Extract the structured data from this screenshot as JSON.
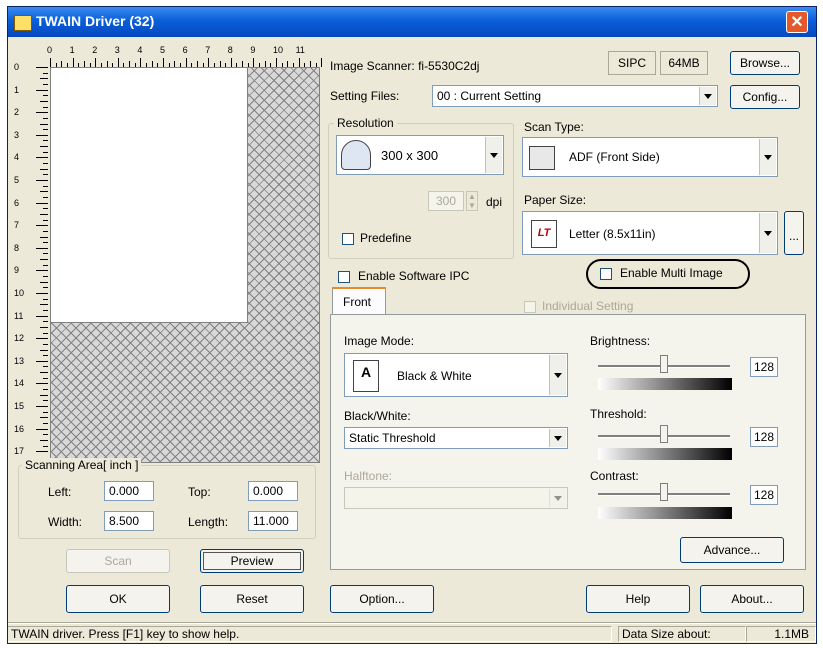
{
  "window": {
    "title": "TWAIN Driver (32)"
  },
  "preview": {
    "ruler_top": [
      "0",
      "1",
      "2",
      "3",
      "4",
      "5",
      "6",
      "7",
      "8",
      "9",
      "10",
      "11"
    ],
    "ruler_left": [
      "0",
      "1",
      "2",
      "3",
      "4",
      "5",
      "6",
      "7",
      "8",
      "9",
      "10",
      "11",
      "12",
      "13",
      "14",
      "15",
      "16",
      "17"
    ]
  },
  "scanning_area": {
    "title": "Scanning Area[ inch ]",
    "left_label": "Left:",
    "left_value": "0.000",
    "top_label": "Top:",
    "top_value": "0.000",
    "width_label": "Width:",
    "width_value": "8.500",
    "length_label": "Length:",
    "length_value": "11.000"
  },
  "buttons": {
    "scan": "Scan",
    "preview": "Preview",
    "ok": "OK",
    "reset": "Reset",
    "option": "Option...",
    "help": "Help",
    "about": "About...",
    "browse": "Browse...",
    "config": "Config...",
    "advance": "Advance...",
    "paper_more": "..."
  },
  "scanner": {
    "label": "Image Scanner:",
    "model": "fi-5530C2dj",
    "ipc": "SIPC",
    "memory": "64MB"
  },
  "setting_files": {
    "label": "Setting Files:",
    "value": "00 : Current Setting"
  },
  "resolution": {
    "title": "Resolution",
    "value": "300 x 300",
    "dpi_value": "300",
    "dpi_unit": "dpi",
    "predefine": "Predefine"
  },
  "scan_type": {
    "label": "Scan Type:",
    "value": "ADF (Front Side)"
  },
  "paper_size": {
    "label": "Paper Size:",
    "value": "Letter (8.5x11in)",
    "icon_text": "LT"
  },
  "options": {
    "software_ipc": "Enable Software IPC",
    "multi_image": "Enable Multi Image",
    "individual": "Individual Setting"
  },
  "tabs": {
    "front": "Front"
  },
  "image_mode": {
    "label": "Image Mode:",
    "value": "Black & White"
  },
  "bw": {
    "label": "Black/White:",
    "value": "Static Threshold"
  },
  "halftone": {
    "label": "Halftone:",
    "value": ""
  },
  "brightness": {
    "label": "Brightness:",
    "value": "128"
  },
  "threshold": {
    "label": "Threshold:",
    "value": "128"
  },
  "contrast": {
    "label": "Contrast:",
    "value": "128"
  },
  "status": {
    "help": "TWAIN driver. Press [F1] key to show help.",
    "size_label": "Data Size about:",
    "size_value": "1.1MB"
  },
  "colors": {
    "title_bar": "#0a5fd8",
    "close": "#e5582a",
    "dialog_bg": "#ece9d8"
  }
}
